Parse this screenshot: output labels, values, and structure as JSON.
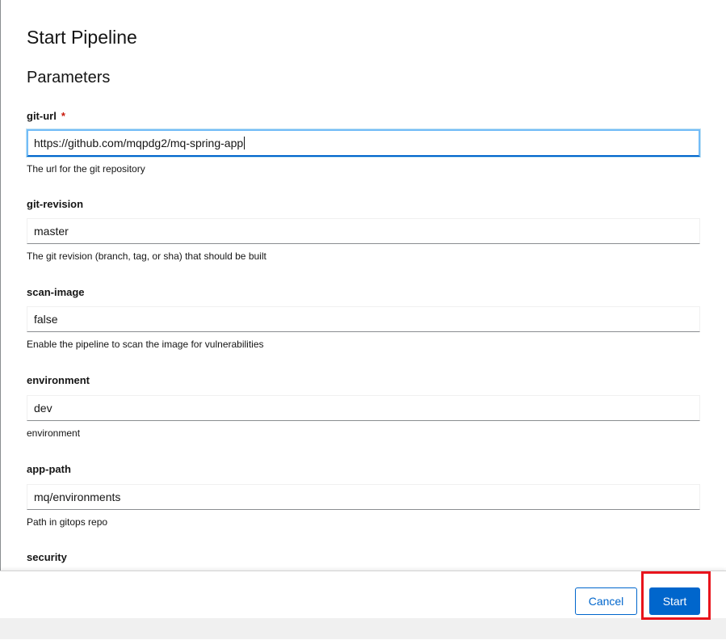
{
  "dialog": {
    "title": "Start Pipeline",
    "section_title": "Parameters"
  },
  "fields": [
    {
      "label": "git-url",
      "required_mark": "*",
      "value": "https://github.com/mqpdg2/mq-spring-app",
      "helper": "The url for the git repository"
    },
    {
      "label": "git-revision",
      "value": "master",
      "helper": "The git revision (branch, tag, or sha) that should be built"
    },
    {
      "label": "scan-image",
      "value": "false",
      "helper": "Enable the pipeline to scan the image for vulnerabilities"
    },
    {
      "label": "environment",
      "value": "dev",
      "helper": "environment"
    },
    {
      "label": "app-path",
      "value": "mq/environments",
      "helper": "Path in gitops repo"
    },
    {
      "label": "security"
    }
  ],
  "footer": {
    "cancel_label": "Cancel",
    "start_label": "Start"
  },
  "colors": {
    "primary": "#0066cc",
    "required": "#c9190b",
    "highlight": "#e8141c"
  }
}
